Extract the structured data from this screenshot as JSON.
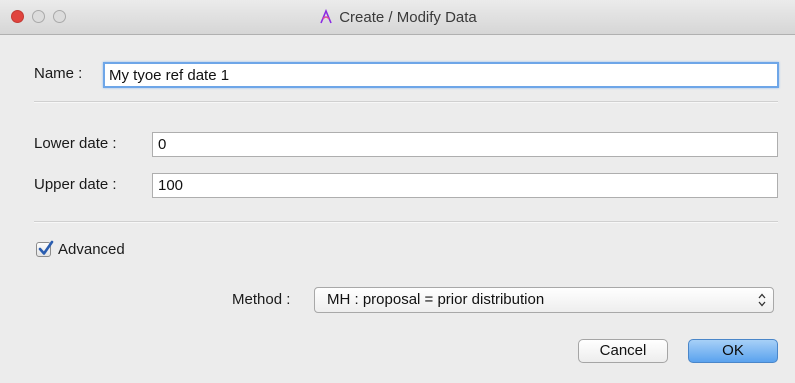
{
  "window": {
    "title": "Create / Modify Data"
  },
  "form": {
    "name_label": "Name :",
    "name_value": "My tyoe ref date 1",
    "lower_label": "Lower date :",
    "lower_value": "0",
    "upper_label": "Upper date :",
    "upper_value": "100",
    "advanced_label": "Advanced",
    "advanced_checked": true,
    "method_label": "Method :",
    "method_value": "MH : proposal = prior distribution"
  },
  "buttons": {
    "cancel": "Cancel",
    "ok": "OK"
  },
  "colors": {
    "close_button": "#e0443e",
    "focus_ring": "#6ea6e8",
    "checkmark": "#2a5db0",
    "ok_button": "#5aa2ee"
  },
  "icons": {
    "app": "app-icon",
    "checkbox": "checkmark-icon",
    "select": "updown-arrows-icon"
  }
}
